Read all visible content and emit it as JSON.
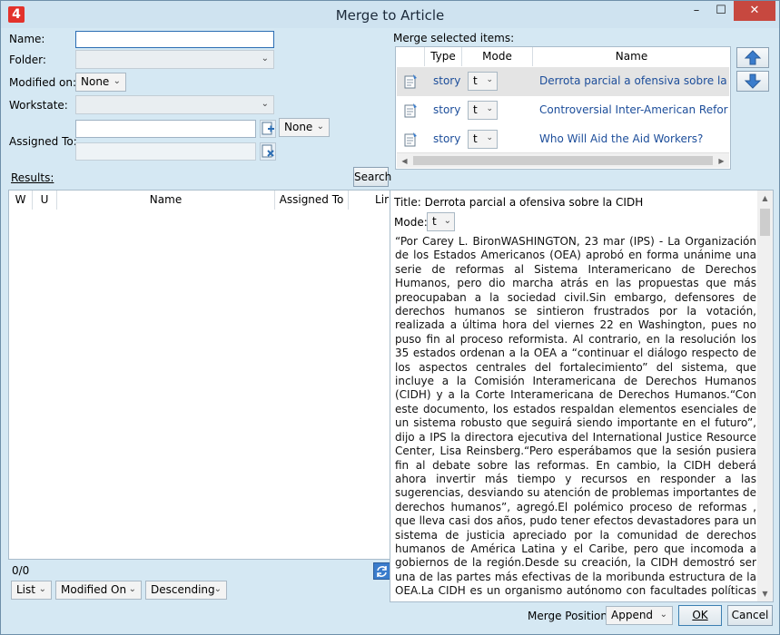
{
  "window": {
    "title": "Merge to Article",
    "app_logo": "4",
    "min": "–",
    "max": "☐",
    "close": "✕"
  },
  "form": {
    "name_label": "Name:",
    "name_value": "",
    "folder_label": "Folder:",
    "modified_label": "Modified on:",
    "modified_value": "None",
    "workstate_label": "Workstate:",
    "assigned_label": "Assigned To:",
    "assigned_combo": "None"
  },
  "results": {
    "label": "Results:",
    "search_button": "Search",
    "columns": [
      "W",
      "U",
      "Name",
      "Assigned To",
      "Lir"
    ],
    "count": "0/0",
    "list_mode": "List",
    "sort_field": "Modified On",
    "sort_order": "Descending"
  },
  "merge_items": {
    "label": "Merge selected items:",
    "columns": [
      "Type",
      "Mode",
      "Name"
    ],
    "rows": [
      {
        "type": "story",
        "mode": "t",
        "name": "Derrota parcial a ofensiva sobre la CIDH"
      },
      {
        "type": "story",
        "mode": "t",
        "name": "Controversial Inter-American Reforms P"
      },
      {
        "type": "story",
        "mode": "t",
        "name": "Who Will Aid the Aid Workers?"
      }
    ]
  },
  "article": {
    "title_line": "Title: Derrota parcial a ofensiva sobre la CIDH",
    "mode_label": "Mode:",
    "mode_value": "t",
    "body": "“Por Carey L. BironWASHINGTON, 23 mar (IPS) - La Organización de los Estados Americanos (OEA) aprobó en forma unánime una serie de reformas al Sistema Interamericano de Derechos Humanos, pero dio marcha atrás en las propuestas que más preocupaban a la sociedad civil.Sin embargo, defensores de derechos humanos se sintieron frustrados por la votación, realizada a última hora del viernes 22 en Washington, pues no puso fin al proceso reformista. Al contrario, en la resolución los 35 estados ordenan a la OEA a “continuar el diálogo respecto de los aspectos centrales del fortalecimiento” del sistema, que incluye a la Comisión Interamericana de Derechos Humanos (CIDH) y a la Corte Interamericana de Derechos Humanos.“Con este documento, los estados respaldan elementos esenciales de un sistema robusto que seguirá siendo importante en el futuro”, dijo a IPS la directora ejecutiva del International Justice Resource Center, Lisa Reinsberg.“Pero esperábamos que la sesión pusiera fin al debate sobre las reformas. En cambio, la CIDH deberá ahora invertir más tiempo y recursos en responder a las sugerencias, desviando su atención de problemas importantes de derechos humanos”, agregó.El polémico proceso de reformas , que lleva casi dos años, pudo tener efectos devastadores para un sistema de justicia apreciado por la comunidad de derechos humanos de América Latina y el Caribe, pero que incomoda a gobiernos de la región.Desde su creación, la CIDH demostró ser una de las partes más efectivas de la moribunda estructura de la OEA.La CIDH es un organismo autónomo con facultades políticas –realizar visitas específicas y emitir recomendaciones e informes– y cuasi judiciales: recibir denuncias de particulares u organizaciones, determinar si son admisibles, solicitar a los Estados medidas cautelares y elevar casos a la Corte. Ambos organismos tienen la función principal de fiscalizar el respeto de la Convención"
  },
  "footer": {
    "merge_position_label": "Merge Position:",
    "merge_position_value": "Append",
    "ok_button": "OK",
    "cancel_button": "Cancel"
  }
}
